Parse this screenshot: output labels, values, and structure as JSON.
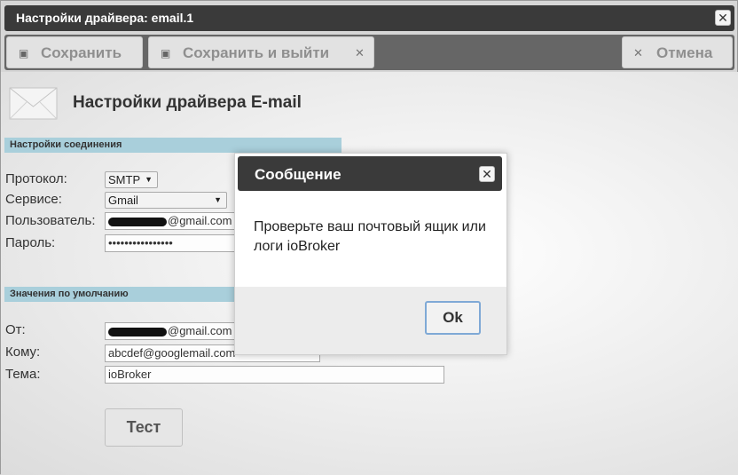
{
  "window": {
    "title": "Настройки драйвера: email.1",
    "close_icon": "close-icon"
  },
  "toolbar": {
    "save_label": "Сохранить",
    "save_exit_label": "Сохранить и выйти",
    "cancel_label": "Отмена",
    "save_icon": "floppy-icon",
    "close_icon": "x-icon"
  },
  "header": {
    "title": "Настройки драйвера E-mail",
    "icon": "envelope-icon"
  },
  "connection": {
    "section_title": "Настройки соединения",
    "protocol_label": "Протокол:",
    "protocol_value": "SMTP",
    "service_label": "Сервисе:",
    "service_value": "Gmail",
    "user_label": "Пользователь:",
    "user_value": "@gmail.com",
    "password_label": "Пароль:",
    "password_value": "••••••••••••••••"
  },
  "defaults": {
    "section_title": "Значения по умолчанию",
    "from_label": "От:",
    "from_value": "@gmail.com",
    "to_label": "Кому:",
    "to_value": "abcdef@googlemail.com",
    "subject_label": "Тема:",
    "subject_value": "ioBroker"
  },
  "test_button_label": "Тест",
  "dialog": {
    "title": "Сообщение",
    "message": "Проверьте ваш почтовый ящик или логи ioBroker",
    "ok_label": "Ok"
  }
}
